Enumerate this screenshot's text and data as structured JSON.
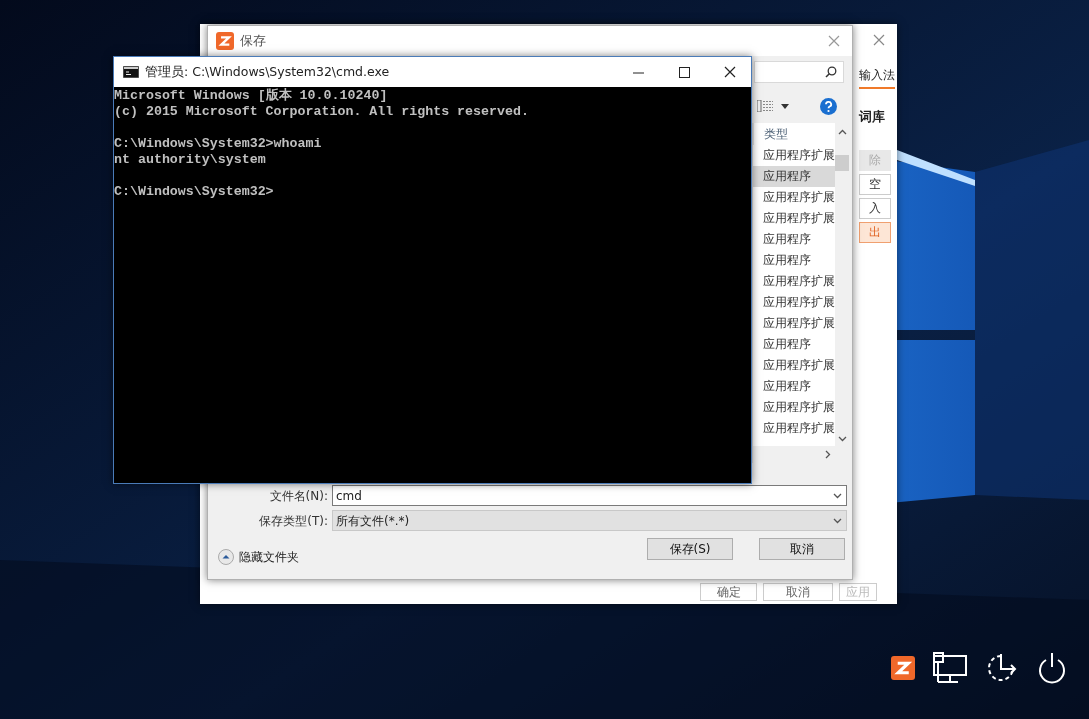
{
  "settings_window": {
    "tabs": [
      {
        "label": "输入法",
        "selected": true
      }
    ],
    "section_title": "词库",
    "side_buttons": [
      {
        "label": "除",
        "disabled": true,
        "focused": false
      },
      {
        "label": "空",
        "disabled": false,
        "focused": false
      },
      {
        "label": "入",
        "disabled": false,
        "focused": false
      },
      {
        "label": "出",
        "disabled": false,
        "focused": true
      }
    ],
    "footer_buttons": [
      {
        "label": "确定",
        "disabled": false
      },
      {
        "label": "取消",
        "disabled": false
      },
      {
        "label": "应用",
        "disabled": true
      }
    ]
  },
  "save_dialog": {
    "title": "保存",
    "column_header": "类型",
    "items": [
      {
        "type": "应用程序扩展",
        "selected": false
      },
      {
        "type": "应用程序",
        "selected": true
      },
      {
        "type": "应用程序扩展",
        "selected": false
      },
      {
        "type": "应用程序扩展",
        "selected": false
      },
      {
        "type": "应用程序",
        "selected": false
      },
      {
        "type": "应用程序",
        "selected": false
      },
      {
        "type": "应用程序扩展",
        "selected": false
      },
      {
        "type": "应用程序扩展",
        "selected": false
      },
      {
        "type": "应用程序扩展",
        "selected": false
      },
      {
        "type": "应用程序",
        "selected": false
      },
      {
        "type": "应用程序扩展",
        "selected": false
      },
      {
        "type": "应用程序",
        "selected": false
      },
      {
        "type": "应用程序扩展",
        "selected": false
      },
      {
        "type": "应用程序扩展",
        "selected": false
      }
    ],
    "file_name": {
      "label": "文件名(N):",
      "value": "cmd"
    },
    "file_type": {
      "label": "保存类型(T):",
      "value": "所有文件(*.*)"
    },
    "hide_folders": "隐藏文件夹",
    "buttons": [
      "保存(S)",
      "取消"
    ]
  },
  "cmd_window": {
    "title": "管理员: C:\\Windows\\System32\\cmd.exe",
    "blocks": [
      [
        "Microsoft Windows [版本 10.0.10240]",
        "(c) 2015 Microsoft Corporation. All rights reserved."
      ],
      [
        "C:\\Windows\\System32>whoami",
        "nt authority\\system"
      ],
      [
        "C:\\Windows\\System32>"
      ]
    ]
  }
}
